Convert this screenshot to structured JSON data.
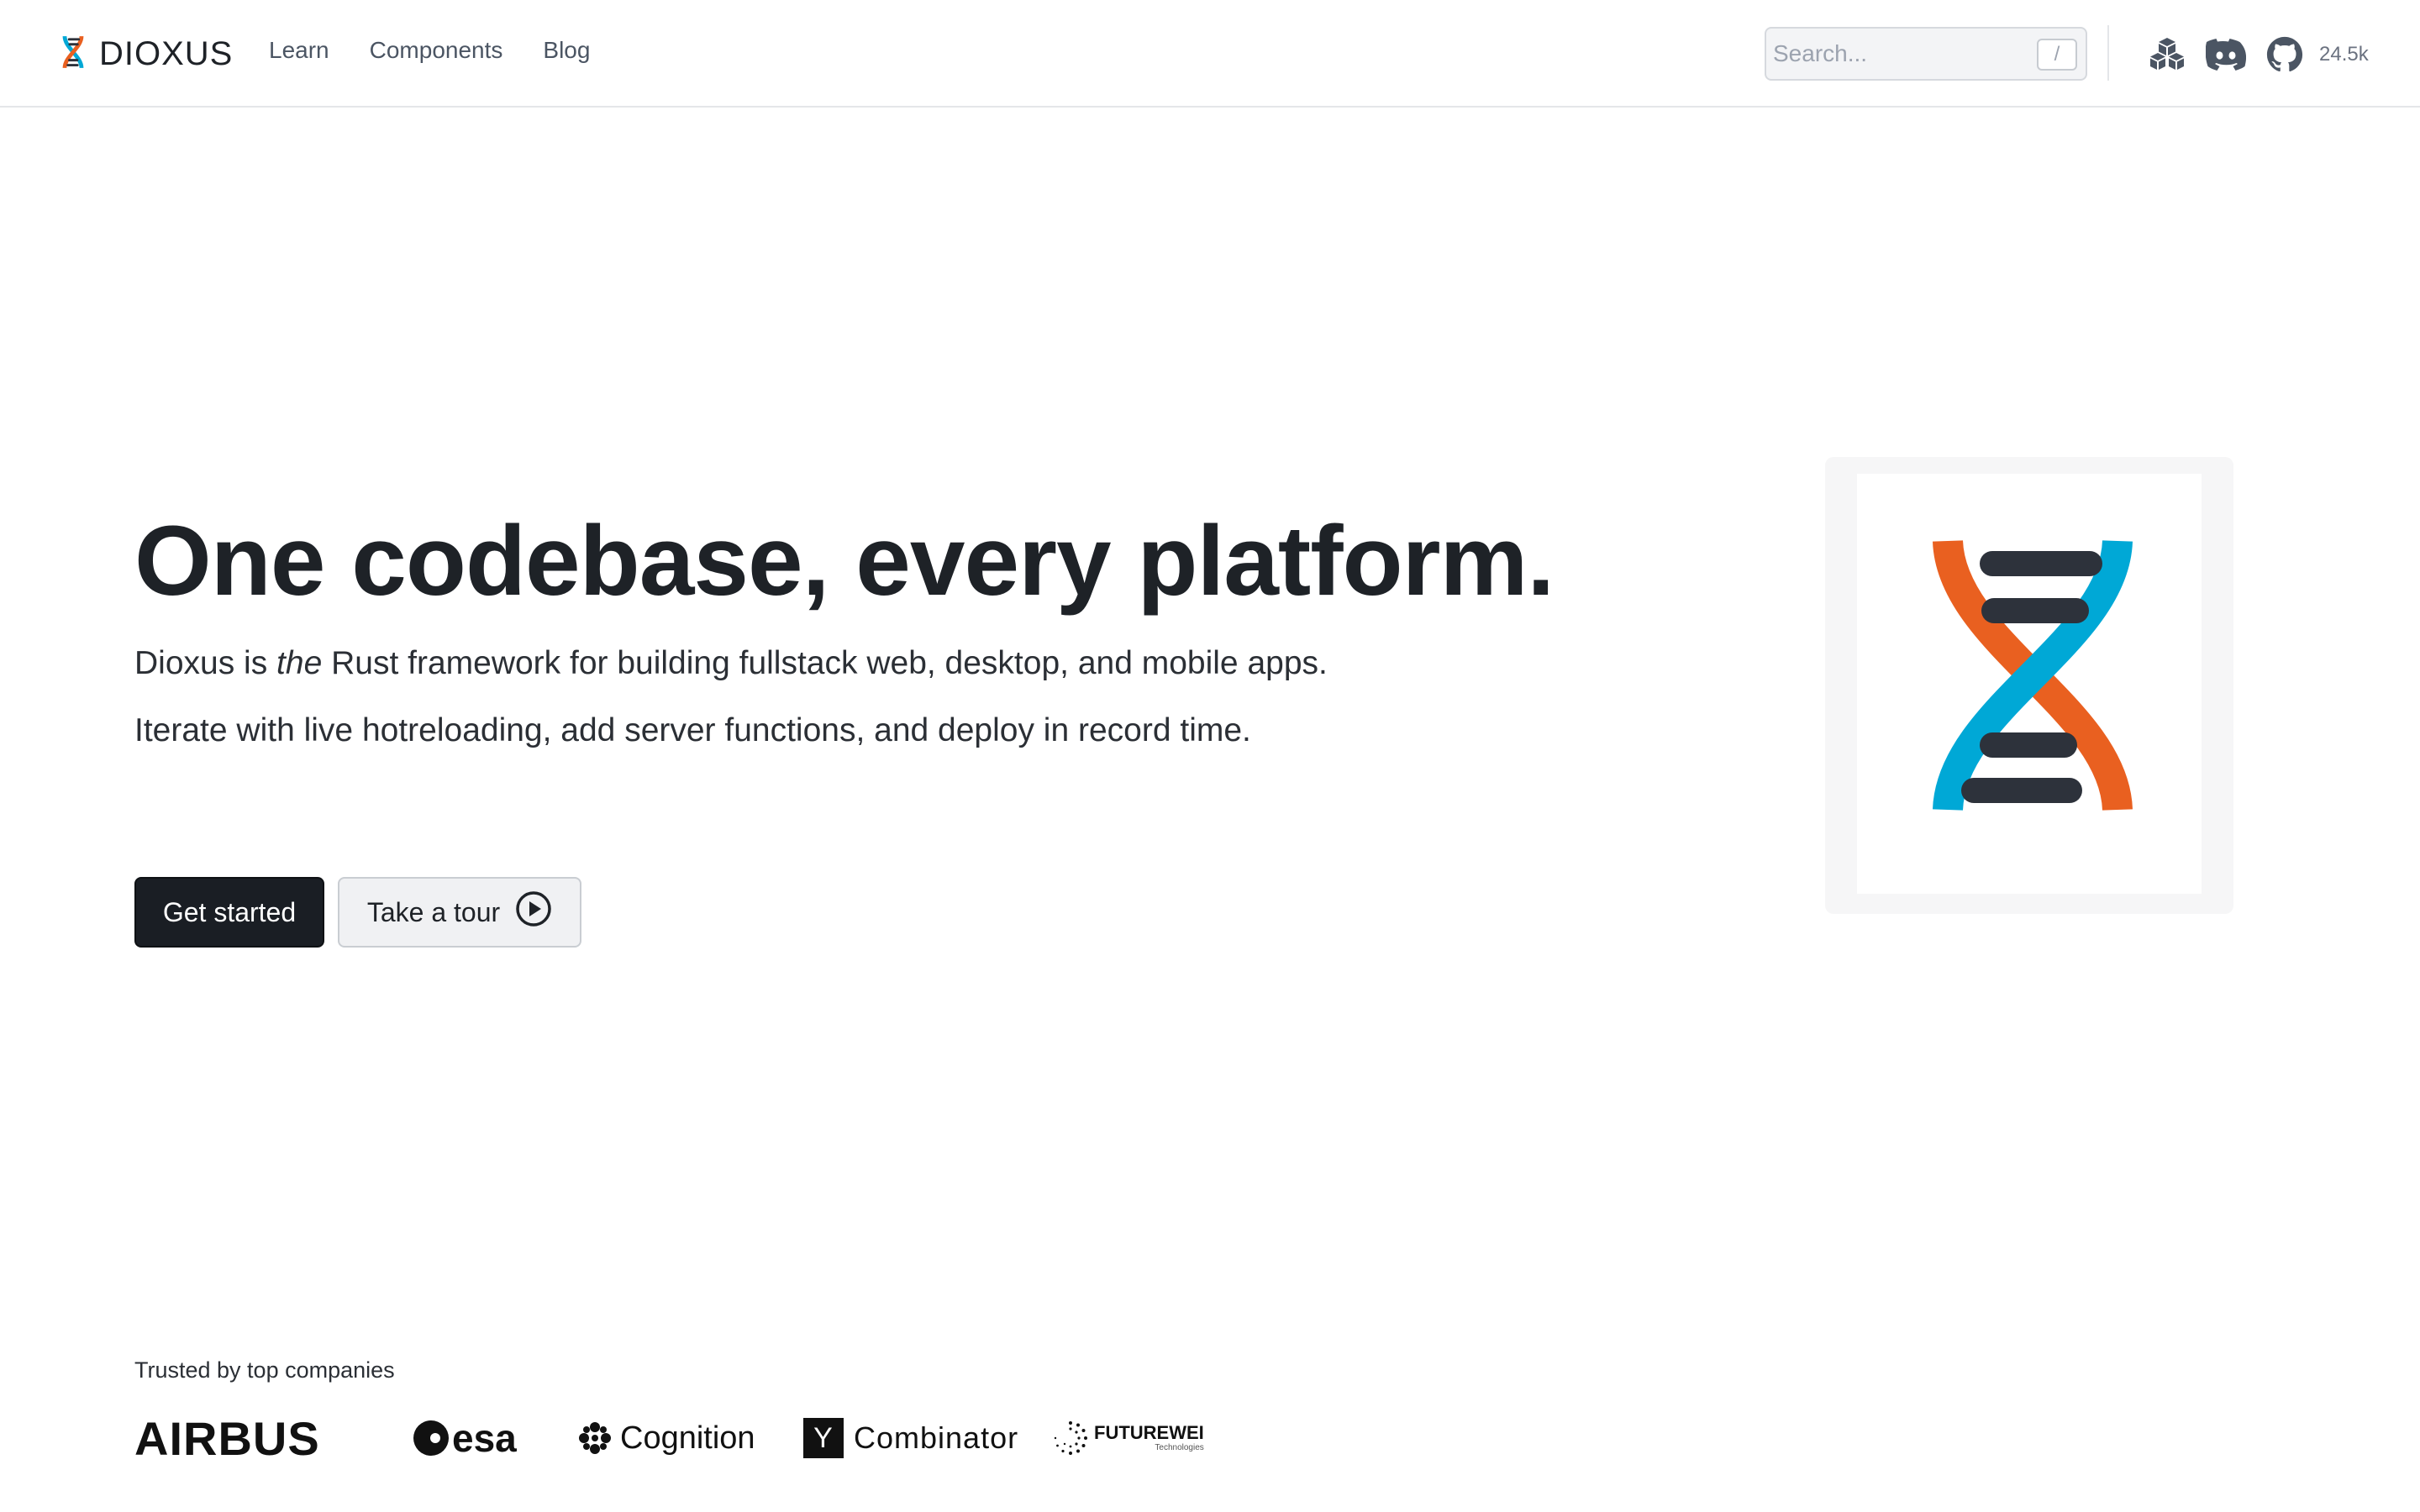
{
  "brand": {
    "name": "DIOXUS",
    "logo_icon": "dna-icon",
    "colors": {
      "blue": "#00a8d6",
      "orange": "#e96020",
      "rung": "#2d323b"
    }
  },
  "nav": {
    "links": [
      {
        "label": "Learn"
      },
      {
        "label": "Components"
      },
      {
        "label": "Blog"
      }
    ],
    "search": {
      "placeholder": "Search...",
      "shortcut": "/"
    },
    "icons": [
      "crates-icon",
      "discord-icon",
      "github-icon"
    ],
    "github_stars": "24.5k"
  },
  "hero": {
    "title": "One codebase, every platform.",
    "subtitle_1": {
      "pre": "Dioxus is ",
      "em": "the",
      "post": " Rust framework for building fullstack web, desktop, and mobile apps."
    },
    "subtitle_2": "Iterate with live hotreloading, add server functions, and deploy in record time.",
    "cta_primary": "Get started",
    "cta_secondary": "Take a tour",
    "cta_secondary_icon": "play-circle-icon"
  },
  "trusted": {
    "label": "Trusted by top companies",
    "logos": {
      "airbus": "AIRBUS",
      "esa": "esa",
      "cognition": "Cognition",
      "yc_letter": "Y",
      "yc": "Combinator",
      "futurewei": "FUTUREWEI",
      "futurewei_sub": "Technologies"
    }
  }
}
